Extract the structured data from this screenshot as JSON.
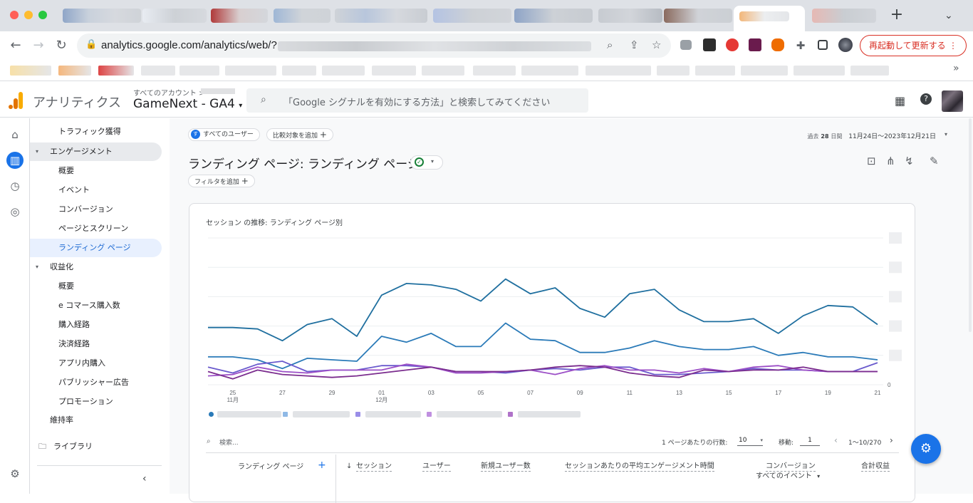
{
  "browser": {
    "url": "analytics.google.com/analytics/web/?",
    "restart_button": "再起動して更新する",
    "restart_more": "⋮",
    "new_tab": "+",
    "tab_menu": "⌄",
    "bookmarks_more": "»"
  },
  "header": {
    "app_title": "アナリティクス",
    "account_crumb": "すべてのアカウント >",
    "property": "GameNext - GA4",
    "property_caret": "▾",
    "search_placeholder": "「Google シグナルを有効にする方法」と検索してみてください"
  },
  "nav": {
    "items": [
      {
        "label": "トラフィック獲得"
      },
      {
        "label": "エンゲージメント"
      },
      {
        "label": "概要"
      },
      {
        "label": "イベント"
      },
      {
        "label": "コンバージョン"
      },
      {
        "label": "ページとスクリーン"
      },
      {
        "label": "ランディング ページ"
      },
      {
        "label": "収益化"
      },
      {
        "label": "概要"
      },
      {
        "label": "e コマース購入数"
      },
      {
        "label": "購入経路"
      },
      {
        "label": "決済経路"
      },
      {
        "label": "アプリ内購入"
      },
      {
        "label": "パブリッシャー広告"
      },
      {
        "label": "プロモーション"
      },
      {
        "label": "維持率"
      },
      {
        "label": "ライブラリ"
      }
    ]
  },
  "report": {
    "segment_badge": "す",
    "segment": "すべてのユーザー",
    "compare": "比較対象を追加",
    "date_prefix": "過去",
    "date_days": "28",
    "date_unit": "日間",
    "date_range": "11月24日～2023年12月21日",
    "title": "ランディング ページ: ランディング ページ",
    "add_filter": "フィルタを追加"
  },
  "chart_data": {
    "type": "line",
    "title": "セッション の推移: ランディング ページ別",
    "x": [
      "11/24",
      "11/25",
      "11/26",
      "11/27",
      "11/28",
      "11/29",
      "11/30",
      "12/01",
      "12/02",
      "12/03",
      "12/04",
      "12/05",
      "12/06",
      "12/07",
      "12/08",
      "12/09",
      "12/10",
      "12/11",
      "12/12",
      "12/13",
      "12/14",
      "12/15",
      "12/16",
      "12/17",
      "12/18",
      "12/19",
      "12/20",
      "12/21"
    ],
    "x_tick_labels": [
      {
        "x": "11/25",
        "day": "25",
        "month": "11月"
      },
      {
        "x": "11/27",
        "day": "27"
      },
      {
        "x": "11/29",
        "day": "29"
      },
      {
        "x": "12/01",
        "day": "01",
        "month": "12月"
      },
      {
        "x": "12/03",
        "day": "03"
      },
      {
        "x": "12/05",
        "day": "05"
      },
      {
        "x": "12/07",
        "day": "07"
      },
      {
        "x": "12/09",
        "day": "09"
      },
      {
        "x": "12/11",
        "day": "11"
      },
      {
        "x": "12/13",
        "day": "13"
      },
      {
        "x": "12/15",
        "day": "15"
      },
      {
        "x": "12/17",
        "day": "17"
      },
      {
        "x": "12/19",
        "day": "19"
      },
      {
        "x": "12/21",
        "day": "21"
      }
    ],
    "y_zero_label": "0",
    "ylim": [
      0,
      100
    ],
    "grid": true,
    "series": [
      {
        "color": "#1f6f9f",
        "values": [
          39,
          39,
          38,
          30,
          41,
          45,
          33,
          61,
          69,
          68,
          65,
          57,
          72,
          62,
          66,
          52,
          46,
          62,
          65,
          51,
          43,
          43,
          45,
          35,
          47,
          54,
          53,
          41
        ]
      },
      {
        "color": "#2a7ab8",
        "values": [
          19,
          19,
          17,
          11,
          18,
          17,
          16,
          33,
          29,
          35,
          26,
          26,
          42,
          31,
          30,
          22,
          22,
          25,
          30,
          26,
          24,
          24,
          26,
          20,
          22,
          19,
          19,
          17
        ]
      },
      {
        "color": "#6a5acd",
        "values": [
          12,
          8,
          14,
          16,
          9,
          10,
          10,
          13,
          13,
          12,
          9,
          9,
          8,
          10,
          11,
          10,
          12,
          12,
          7,
          7,
          8,
          9,
          11,
          10,
          10,
          9,
          9,
          15
        ]
      },
      {
        "color": "#9c4fc7",
        "values": [
          6,
          7,
          12,
          9,
          8,
          10,
          10,
          10,
          14,
          12,
          8,
          8,
          9,
          10,
          7,
          11,
          13,
          10,
          10,
          8,
          11,
          9,
          12,
          13,
          10,
          9,
          9,
          9
        ]
      },
      {
        "color": "#7b2d8e",
        "values": [
          9,
          4,
          10,
          7,
          6,
          5,
          6,
          8,
          10,
          12,
          9,
          9,
          9,
          10,
          12,
          13,
          12,
          8,
          6,
          5,
          10,
          9,
          10,
          10,
          12,
          9,
          9,
          9
        ]
      }
    ]
  },
  "table": {
    "search_placeholder": "検索...",
    "rows_label": "1 ページあたりの行数:",
    "rows_value": "10",
    "goto_label": "移動:",
    "goto_value": "1",
    "page_range": "1〜10/270",
    "columns": {
      "dimension": "ランディング ページ",
      "add_dimension": "+",
      "sort_arrow": "↓",
      "sessions": "セッション",
      "users": "ユーザー",
      "new_users": "新規ユーザー数",
      "avg_engagement": "セッションあたりの平均エンゲージメント時間",
      "conversions": "コンバージョン",
      "conversions_sub": "すべてのイベント",
      "revenue": "合計収益"
    }
  },
  "colors": {
    "accent": "#1a73e8",
    "restart": "#d93025",
    "ga_orange": "#f9ab00",
    "ga_dark_orange": "#e37400"
  }
}
